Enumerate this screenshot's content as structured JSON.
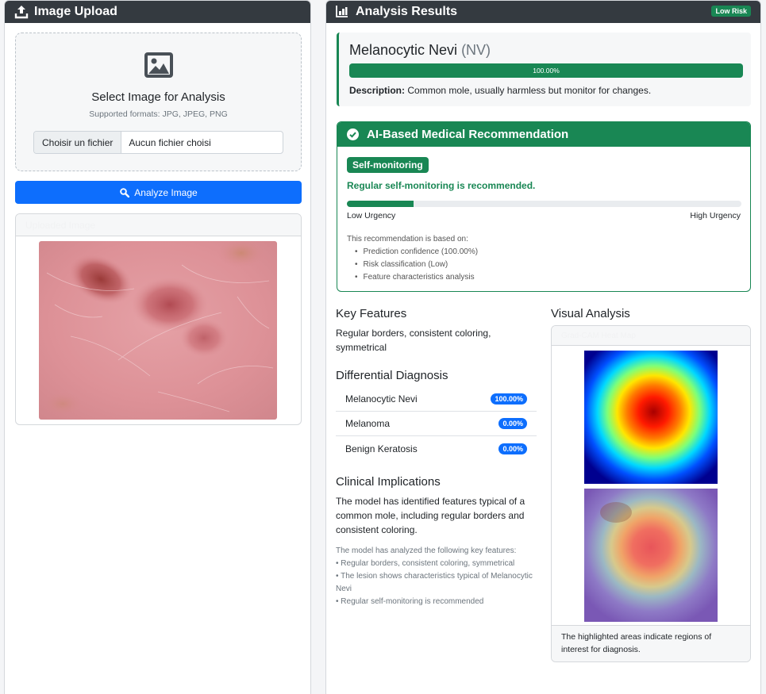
{
  "upload_panel": {
    "title": "Image Upload",
    "select_title": "Select Image for Analysis",
    "formats": "Supported formats: JPG, JPEG, PNG",
    "file_button": "Choisir un fichier",
    "file_status": "Aucun fichier choisi",
    "analyze_button": "Analyze Image",
    "uploaded_header": "Uploaded Image"
  },
  "results_panel": {
    "title": "Analysis Results",
    "risk_badge": "Low Risk",
    "diagnosis": {
      "name": "Melanocytic Nevi",
      "abbr": "(NV)",
      "confidence_label": "100.00%",
      "confidence": 1.0,
      "description_label": "Description:",
      "description": "Common mole, usually harmless but monitor for changes."
    },
    "recommendation": {
      "header": "AI-Based Medical Recommendation",
      "pill": "Self-monitoring",
      "text": "Regular self-monitoring is recommended.",
      "urgency": 0.17,
      "low_label": "Low Urgency",
      "high_label": "High Urgency",
      "basis_intro": "This recommendation is based on:",
      "basis_items": [
        "Prediction confidence (100.00%)",
        "Risk classification (Low)",
        "Feature characteristics analysis"
      ]
    },
    "key_features": {
      "title": "Key Features",
      "text": "Regular borders, consistent coloring, symmetrical"
    },
    "differential": {
      "title": "Differential Diagnosis",
      "rows": [
        {
          "name": "Melanocytic Nevi",
          "value": "100.00%"
        },
        {
          "name": "Melanoma",
          "value": "0.00%"
        },
        {
          "name": "Benign Keratosis",
          "value": "0.00%"
        }
      ]
    },
    "clinical": {
      "title": "Clinical Implications",
      "text": "The model has identified features typical of a common mole, including regular borders and consistent coloring.",
      "detail_lines": [
        "The model has analyzed the following key features:",
        "• Regular borders, consistent coloring, symmetrical",
        "• The lesion shows characteristics typical of Melanocytic Nevi",
        "• Regular self-monitoring is recommended"
      ]
    },
    "visual": {
      "title": "Visual Analysis",
      "header": "Grad-CAM Heat Map",
      "footer": "The highlighted areas indicate regions of interest for diagnosis."
    }
  }
}
